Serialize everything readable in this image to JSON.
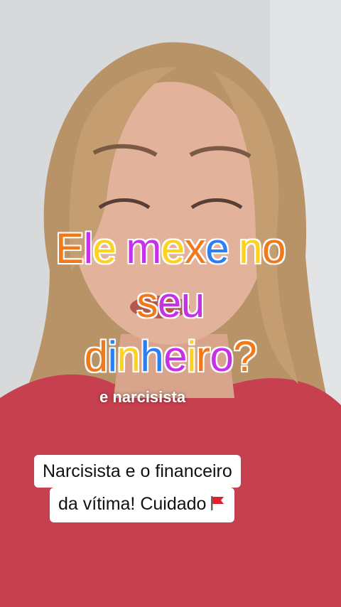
{
  "headline": {
    "lines": [
      {
        "words": [
          {
            "text": "Ele",
            "colors": [
              "#f07a1a",
              "#c630e6",
              "#ffd21f"
            ]
          },
          {
            "text": "mexe",
            "colors": [
              "#c630e6",
              "#ffd21f",
              "#f07a1a",
              "#2f7df0"
            ]
          },
          {
            "text": "no",
            "colors": [
              "#ffd21f",
              "#f07a1a"
            ]
          }
        ]
      },
      {
        "words": [
          {
            "text": "seu",
            "colors": [
              "#f07a1a",
              "#c630e6",
              "#c630e6"
            ]
          }
        ]
      },
      {
        "words": [
          {
            "text": "dinheiro?",
            "colors": [
              "#f07a1a",
              "#2f7df0",
              "#ffd21f",
              "#2f7df0",
              "#c630e6",
              "#ffd21f",
              "#f07a1a",
              "#c630e6",
              "#f07a1a"
            ]
          }
        ]
      }
    ]
  },
  "subcaption": "e narcisista",
  "caption": {
    "line1": "Narcisista e o financeiro",
    "line2": "da vítima! Cuidado",
    "flag_icon": "red-flag-emoji"
  }
}
